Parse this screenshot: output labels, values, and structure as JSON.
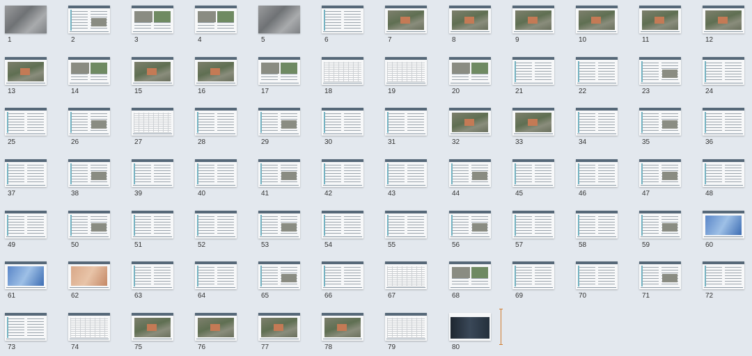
{
  "page_numbers": [
    "1",
    "2",
    "3",
    "4",
    "5",
    "6",
    "7",
    "8",
    "9",
    "10",
    "11",
    "12",
    "13",
    "14",
    "15",
    "16",
    "17",
    "18",
    "19",
    "20",
    "21",
    "22",
    "23",
    "24",
    "25",
    "26",
    "27",
    "28",
    "29",
    "30",
    "31",
    "32",
    "33",
    "34",
    "35",
    "36",
    "37",
    "38",
    "39",
    "40",
    "41",
    "42",
    "43",
    "44",
    "45",
    "46",
    "47",
    "48",
    "49",
    "50",
    "51",
    "52",
    "53",
    "54",
    "55",
    "56",
    "57",
    "58",
    "59",
    "60",
    "61",
    "62",
    "63",
    "64",
    "65",
    "66",
    "67",
    "68",
    "69",
    "70",
    "71",
    "72",
    "73",
    "74",
    "75",
    "76",
    "77",
    "78",
    "79",
    "80"
  ],
  "thumbnail_kinds": [
    "photo",
    "doc",
    "mixed",
    "mixed",
    "photo",
    "doc",
    "aerial",
    "aerial",
    "aerial",
    "aerial",
    "aerial",
    "aerial",
    "aerial",
    "mixed",
    "aerial",
    "aerial",
    "mixed",
    "table",
    "table",
    "mixed",
    "doc",
    "doc",
    "doc",
    "doc",
    "doc",
    "doc",
    "table",
    "doc",
    "doc",
    "doc",
    "doc",
    "aerial",
    "aerial",
    "doc",
    "doc",
    "doc",
    "doc",
    "doc",
    "doc",
    "doc",
    "doc",
    "doc",
    "doc",
    "doc",
    "doc",
    "doc",
    "doc",
    "doc",
    "doc",
    "doc",
    "doc",
    "doc",
    "doc",
    "doc",
    "doc",
    "doc",
    "doc",
    "doc",
    "doc",
    "blue",
    "blue",
    "orange",
    "doc",
    "doc",
    "doc",
    "doc",
    "table",
    "mixed",
    "doc",
    "doc",
    "doc",
    "doc",
    "doc",
    "table",
    "aerial",
    "aerial",
    "aerial",
    "aerial",
    "table",
    "dark"
  ],
  "colors": {
    "background": "#e3e8ee",
    "page_header_band": "#566878",
    "scroll_indicator": "#d07a2c"
  }
}
